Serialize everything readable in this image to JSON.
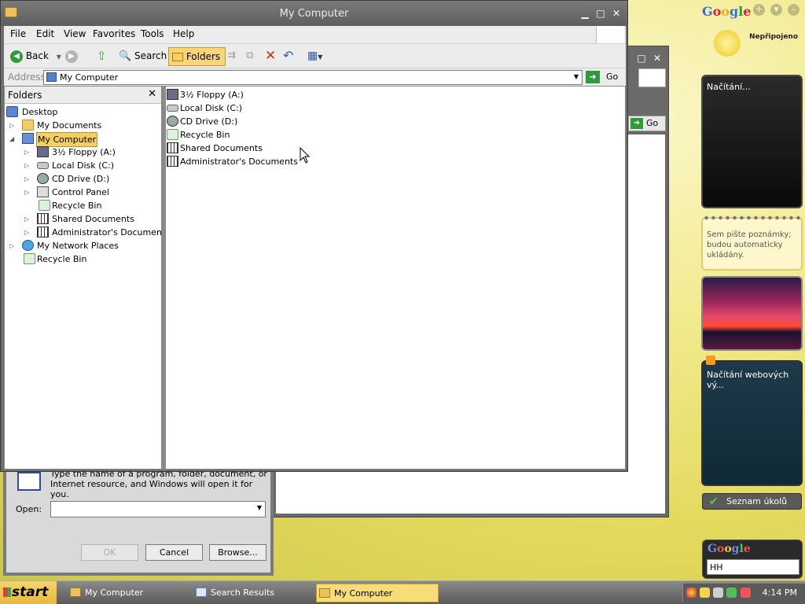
{
  "explorer": {
    "title": "My Computer",
    "menu": [
      "File",
      "Edit",
      "View",
      "Favorites",
      "Tools",
      "Help"
    ],
    "toolbar": {
      "back": "Back",
      "search": "Search",
      "folders": "Folders"
    },
    "address": {
      "label": "Address",
      "value": "My Computer",
      "go": "Go"
    },
    "folders_pane": {
      "title": "Folders",
      "tree": [
        {
          "label": "Desktop"
        },
        {
          "label": "My Documents"
        },
        {
          "label": "My Computer"
        },
        {
          "label": "3½ Floppy (A:)"
        },
        {
          "label": "Local Disk (C:)"
        },
        {
          "label": "CD Drive (D:)"
        },
        {
          "label": "Control Panel"
        },
        {
          "label": "Recycle Bin"
        },
        {
          "label": "Shared Documents"
        },
        {
          "label": "Administrator's Documents"
        },
        {
          "label": "My Network Places"
        },
        {
          "label": "Recycle Bin"
        }
      ]
    },
    "files": [
      {
        "label": "3½ Floppy (A:)"
      },
      {
        "label": "Local Disk (C:)"
      },
      {
        "label": "CD Drive (D:)"
      },
      {
        "label": "Recycle Bin"
      },
      {
        "label": "Shared Documents"
      },
      {
        "label": "Administrator's Documents"
      }
    ]
  },
  "background_window": {
    "go": "Go"
  },
  "run_dialog": {
    "description": "Type the name of a program, folder, document, or Internet resource, and Windows will open it for you.",
    "open_label": "Open:",
    "open_value": "",
    "ok": "OK",
    "cancel": "Cancel",
    "browse": "Browse..."
  },
  "sidebar": {
    "google": "Google",
    "status": "Nepřipojeno",
    "gadget1": "Načítání...",
    "notes": "Sem pište poznámky; budou automaticky ukládány.",
    "feed": "Načítání webových vý...",
    "tasks": "Seznam úkolů",
    "search_logo": "Google",
    "search_value": "HH"
  },
  "taskbar": {
    "start": "start",
    "buttons": [
      "My Computer",
      "Search Results",
      "My Computer"
    ],
    "clock": "4:14 PM"
  }
}
